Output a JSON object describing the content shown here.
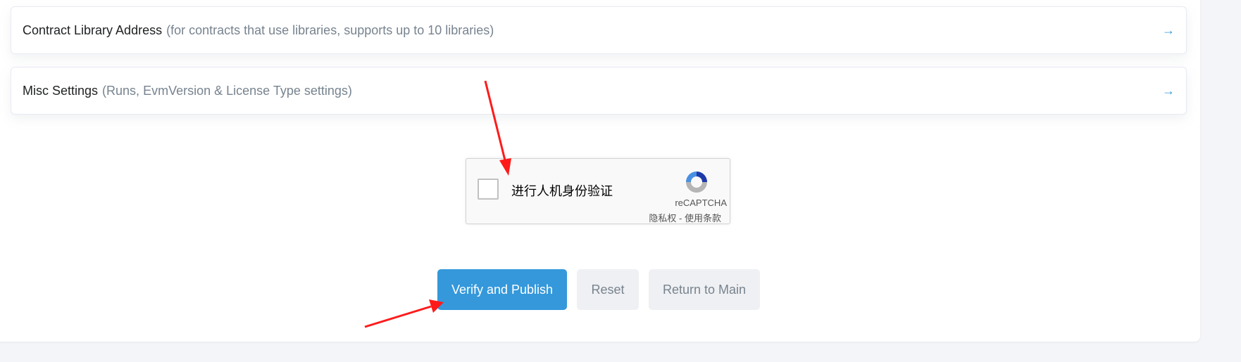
{
  "cards": [
    {
      "title": "Contract Library Address",
      "subtitle": "(for contracts that use libraries, supports up to 10 libraries)",
      "icon": "arrow-right-icon"
    },
    {
      "title": "Misc Settings",
      "subtitle": "(Runs, EvmVersion & License Type settings)",
      "icon": "arrow-right-icon"
    }
  ],
  "captcha": {
    "label": "进行人机身份验证",
    "brand": "reCAPTCHA",
    "privacy": "隐私权",
    "separator": " - ",
    "terms": "使用条款"
  },
  "buttons": {
    "verify": "Verify and Publish",
    "reset": "Reset",
    "return": "Return to Main"
  },
  "colors": {
    "accent": "#3498db",
    "annotation": "#ff1a1a"
  }
}
